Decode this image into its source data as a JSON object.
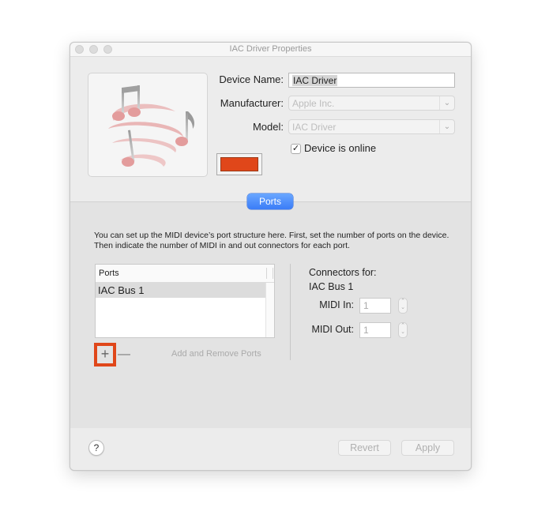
{
  "window": {
    "title": "IAC Driver Properties"
  },
  "device": {
    "name_label": "Device Name:",
    "name_value": "IAC Driver",
    "manufacturer_label": "Manufacturer:",
    "manufacturer_value": "Apple Inc.",
    "model_label": "Model:",
    "model_value": "IAC Driver",
    "online_label": "Device is online",
    "online_checked": true,
    "checkmark": "✓",
    "color": "#e0471a",
    "icon": "midi-notes-icon"
  },
  "tabs": {
    "active": "Ports"
  },
  "ports": {
    "description": "You can set up the MIDI device’s port structure here. First, set the number of ports on the device. Then indicate the number of MIDI in and out connectors for each port.",
    "table_header": "Ports",
    "rows": [
      "IAC Bus 1"
    ],
    "add_symbol": "+",
    "remove_symbol": "—",
    "add_remove_label": "Add and Remove Ports",
    "connectors_title": "Connectors for:",
    "connectors_port": "IAC Bus 1",
    "midi_in_label": "MIDI In:",
    "midi_in_value": "1",
    "midi_out_label": "MIDI Out:",
    "midi_out_value": "1"
  },
  "footer": {
    "help_symbol": "?",
    "revert_label": "Revert",
    "apply_label": "Apply"
  },
  "colors": {
    "accent": "#3a7cf7",
    "highlight": "#e0471a"
  }
}
